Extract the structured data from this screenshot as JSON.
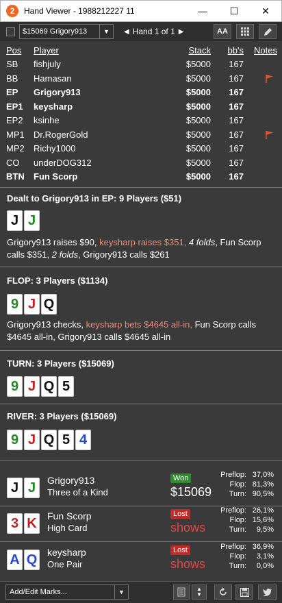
{
  "window": {
    "title": "Hand Viewer - 1988212227 11",
    "app_icon": "2",
    "minimize": "—",
    "maximize": "☐",
    "close": "✕"
  },
  "toolbar": {
    "session_select": "$15069 Grigory913",
    "hand_label": "Hand 1 of 1",
    "font_button": "AA",
    "grid_icon": "grid-icon",
    "edit_icon": "pencil-icon"
  },
  "table": {
    "headers": {
      "pos": "Pos",
      "player": "Player",
      "stack": "Stack",
      "bb": "bb's",
      "notes": "Notes"
    },
    "rows": [
      {
        "pos": "SB",
        "player": "fishjuly",
        "stack": "$5000",
        "bb": "167",
        "bold": false,
        "flag": false
      },
      {
        "pos": "BB",
        "player": "Hamasan",
        "stack": "$5000",
        "bb": "167",
        "bold": false,
        "flag": true
      },
      {
        "pos": "EP",
        "player": "Grigory913",
        "stack": "$5000",
        "bb": "167",
        "bold": true,
        "flag": false
      },
      {
        "pos": "EP1",
        "player": "keysharp",
        "stack": "$5000",
        "bb": "167",
        "bold": true,
        "flag": false
      },
      {
        "pos": "EP2",
        "player": "ksinhe",
        "stack": "$5000",
        "bb": "167",
        "bold": false,
        "flag": false
      },
      {
        "pos": "MP1",
        "player": "Dr.RogerGold",
        "stack": "$5000",
        "bb": "167",
        "bold": false,
        "flag": true
      },
      {
        "pos": "MP2",
        "player": "Richy1000",
        "stack": "$5000",
        "bb": "167",
        "bold": false,
        "flag": false
      },
      {
        "pos": "CO",
        "player": "underDOG312",
        "stack": "$5000",
        "bb": "167",
        "bold": false,
        "flag": false
      },
      {
        "pos": "BTN",
        "player": "Fun Scorp",
        "stack": "$5000",
        "bb": "167",
        "bold": true,
        "flag": false
      }
    ]
  },
  "preflop": {
    "title": "Dealt to Grigory913 in EP: 9 Players ($51)",
    "cards": [
      {
        "rank": "J",
        "suit": "s"
      },
      {
        "rank": "J",
        "suit": "c"
      }
    ],
    "action": [
      {
        "text": "Grigory913 raises $90, ",
        "style": ""
      },
      {
        "text": "keysharp raises $351, ",
        "style": "raise"
      },
      {
        "text": "4 folds",
        "style": "ital"
      },
      {
        "text": ", Fun Scorp calls $351, ",
        "style": ""
      },
      {
        "text": "2 folds",
        "style": "ital"
      },
      {
        "text": ", Grigory913 calls $261",
        "style": ""
      }
    ]
  },
  "flop": {
    "title": "FLOP: 3 Players ($1134)",
    "cards": [
      {
        "rank": "9",
        "suit": "c"
      },
      {
        "rank": "J",
        "suit": "h"
      },
      {
        "rank": "Q",
        "suit": "s"
      }
    ],
    "action": [
      {
        "text": "Grigory913 checks, ",
        "style": ""
      },
      {
        "text": "keysharp bets $4645 all-in, ",
        "style": "raise"
      },
      {
        "text": "Fun Scorp calls $4645 all-in, Grigory913 calls $4645 all-in",
        "style": ""
      }
    ]
  },
  "turn": {
    "title": "TURN: 3 Players ($15069)",
    "cards": [
      {
        "rank": "9",
        "suit": "c"
      },
      {
        "rank": "J",
        "suit": "h"
      },
      {
        "rank": "Q",
        "suit": "s"
      },
      {
        "rank": "5",
        "suit": "s"
      }
    ]
  },
  "river": {
    "title": "RIVER: 3 Players ($15069)",
    "cards": [
      {
        "rank": "9",
        "suit": "c"
      },
      {
        "rank": "J",
        "suit": "h"
      },
      {
        "rank": "Q",
        "suit": "s"
      },
      {
        "rank": "5",
        "suit": "s"
      },
      {
        "rank": "4",
        "suit": "d"
      }
    ]
  },
  "results": [
    {
      "name": "Grigory913",
      "hand": "Three of a Kind",
      "cards": [
        {
          "rank": "J",
          "suit": "s"
        },
        {
          "rank": "J",
          "suit": "c"
        }
      ],
      "badge": "Won",
      "outcome": "won",
      "amount": "$15069",
      "equity": [
        {
          "label": "Preflop:",
          "value": "37,0%"
        },
        {
          "label": "Flop:",
          "value": "81,3%"
        },
        {
          "label": "Turn:",
          "value": "90,5%"
        }
      ]
    },
    {
      "name": "Fun Scorp",
      "hand": "High Card",
      "cards": [
        {
          "rank": "3",
          "suit": "h"
        },
        {
          "rank": "K",
          "suit": "h"
        }
      ],
      "badge": "Lost",
      "outcome": "lost",
      "amount": "shows",
      "equity": [
        {
          "label": "Preflop:",
          "value": "26,1%"
        },
        {
          "label": "Flop:",
          "value": "15,6%"
        },
        {
          "label": "Turn:",
          "value": "9,5%"
        }
      ]
    },
    {
      "name": "keysharp",
      "hand": "One Pair",
      "cards": [
        {
          "rank": "A",
          "suit": "d"
        },
        {
          "rank": "Q",
          "suit": "d"
        }
      ],
      "badge": "Lost",
      "outcome": "lost",
      "amount": "shows",
      "equity": [
        {
          "label": "Preflop:",
          "value": "36,9%"
        },
        {
          "label": "Flop:",
          "value": "3,1%"
        },
        {
          "label": "Turn:",
          "value": "0,0%"
        }
      ]
    }
  ],
  "bottombar": {
    "marks_placeholder": "Add/Edit Marks...",
    "icons": [
      "notes-icon",
      "stepper-icon",
      "replay-icon",
      "save-icon",
      "twitter-icon"
    ]
  },
  "colors": {
    "background": "#3a3a3a",
    "raise_text": "#f08a78",
    "won_badge": "#2e8b2e",
    "lost_badge": "#c62828",
    "flag": "#e8552a"
  }
}
